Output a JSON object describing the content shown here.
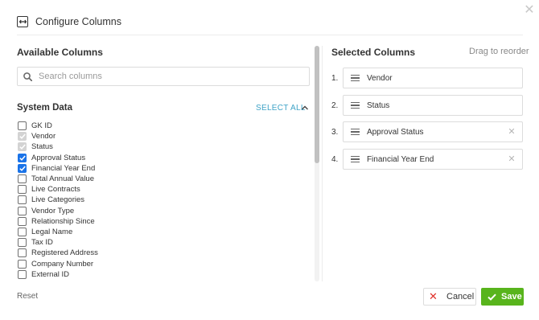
{
  "dialog": {
    "title": "Configure Columns",
    "close_icon": "close-icon"
  },
  "available": {
    "heading": "Available Columns",
    "search": {
      "placeholder": "Search columns",
      "value": ""
    },
    "group": {
      "title": "System Data",
      "select_all_label": "SELECT ALL",
      "expanded": true
    },
    "items": [
      {
        "label": "GK ID",
        "state": "unchecked"
      },
      {
        "label": "Vendor",
        "state": "checked-disabled"
      },
      {
        "label": "Status",
        "state": "checked-disabled"
      },
      {
        "label": "Approval Status",
        "state": "checked"
      },
      {
        "label": "Financial Year End",
        "state": "checked"
      },
      {
        "label": "Total Annual Value",
        "state": "unchecked"
      },
      {
        "label": "Live Contracts",
        "state": "unchecked"
      },
      {
        "label": "Live Categories",
        "state": "unchecked"
      },
      {
        "label": "Vendor Type",
        "state": "unchecked"
      },
      {
        "label": "Relationship Since",
        "state": "unchecked"
      },
      {
        "label": "Legal Name",
        "state": "unchecked"
      },
      {
        "label": "Tax ID",
        "state": "unchecked"
      },
      {
        "label": "Registered Address",
        "state": "unchecked"
      },
      {
        "label": "Company Number",
        "state": "unchecked"
      },
      {
        "label": "External ID",
        "state": "unchecked"
      }
    ]
  },
  "selected": {
    "heading": "Selected Columns",
    "drag_hint": "Drag to reorder",
    "items": [
      {
        "number": "1.",
        "label": "Vendor",
        "removable": false
      },
      {
        "number": "2.",
        "label": "Status",
        "removable": false
      },
      {
        "number": "3.",
        "label": "Approval Status",
        "removable": true
      },
      {
        "number": "4.",
        "label": "Financial Year End",
        "removable": true
      }
    ]
  },
  "footer": {
    "reset_label": "Reset",
    "cancel_label": "Cancel",
    "save_label": "Save"
  },
  "colors": {
    "checkbox_checked": "#1a73e8",
    "select_all_link": "#3ea3c7",
    "save_button": "#58b41c",
    "cancel_icon": "#e0322b"
  }
}
